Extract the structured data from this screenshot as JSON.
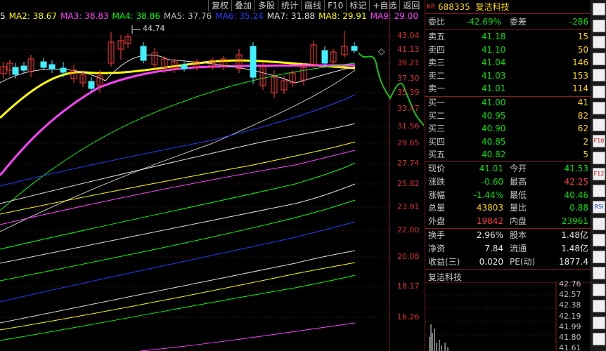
{
  "toolbar": {
    "items": [
      "复权",
      "叠加",
      "多股",
      "统计",
      "画线",
      "F10",
      "标记",
      "+自选",
      "返回"
    ]
  },
  "ma_row": [
    {
      "label": "5",
      "color": "#ffffff"
    },
    {
      "label": "MA2: 38.67",
      "color": "#ffff00"
    },
    {
      "label": "MA3: 38.83",
      "color": "#ff40ff"
    },
    {
      "label": "MA4: 38.86",
      "color": "#00ff00"
    },
    {
      "label": "MA5: 37.76",
      "color": "#c0c0c0"
    },
    {
      "label": "MA6: 35.24",
      "color": "#2040ff"
    },
    {
      "label": "MA7: 31.88",
      "color": "#e0e0e0"
    },
    {
      "label": "MA8: 29.91",
      "color": "#ffff00"
    },
    {
      "label": "MA9: 29.00",
      "color": "#ff40ff"
    }
  ],
  "chart": {
    "high_label": "44.74",
    "price_labels": [
      "43.04",
      "41.13",
      "39.21",
      "37.30",
      "35.39",
      "33.47",
      "31.56",
      "29.65",
      "27.74",
      "25.82",
      "23.91",
      "22.00",
      "20.08",
      "18.17",
      "16.26"
    ],
    "diamond": "◇"
  },
  "quote": {
    "tag": "KR",
    "code": "688335",
    "name": "复洁科技",
    "weibi_label": "委比",
    "weibi_value": "-42.69%",
    "weicha_label": "委差",
    "weicha_value": "-286",
    "asks": [
      {
        "label": "卖五",
        "price": "41.18",
        "vol": "15"
      },
      {
        "label": "卖四",
        "price": "41.10",
        "vol": "50"
      },
      {
        "label": "卖三",
        "price": "41.04",
        "vol": "146"
      },
      {
        "label": "卖二",
        "price": "41.03",
        "vol": "153"
      },
      {
        "label": "卖一",
        "price": "41.01",
        "vol": "114"
      }
    ],
    "bids": [
      {
        "label": "买一",
        "price": "41.00",
        "vol": "41"
      },
      {
        "label": "买二",
        "price": "40.95",
        "vol": "82"
      },
      {
        "label": "买三",
        "price": "40.90",
        "vol": "62"
      },
      {
        "label": "买四",
        "price": "40.85",
        "vol": "2"
      },
      {
        "label": "买五",
        "price": "40.82",
        "vol": "5"
      }
    ],
    "stats": [
      {
        "l1": "现价",
        "v1": "41.01",
        "c1": "green",
        "l2": "今开",
        "v2": "41.53",
        "c2": "green"
      },
      {
        "l1": "涨跌",
        "v1": "-0.60",
        "c1": "green",
        "l2": "最高",
        "v2": "42.25",
        "c2": "red"
      },
      {
        "l1": "涨幅",
        "v1": "-1.44%",
        "c1": "green",
        "l2": "最低",
        "v2": "40.46",
        "c2": "green"
      },
      {
        "l1": "总量",
        "v1": "43803",
        "c1": "yellow",
        "l2": "量比",
        "v2": "0.88",
        "c2": "green"
      },
      {
        "l1": "外盘",
        "v1": "19842",
        "c1": "red",
        "l2": "内盘",
        "v2": "23961",
        "c2": "green"
      }
    ],
    "stats2": [
      {
        "l1": "换手",
        "v1": "2.96%",
        "l2": "股本",
        "v2": "1.48亿"
      },
      {
        "l1": "净资",
        "v1": "7.84",
        "l2": "流通",
        "v2": "1.48亿"
      },
      {
        "l1": "收益(三)",
        "v1": "0.020",
        "l2": "PE(动)",
        "v2": "1877.4"
      }
    ]
  },
  "mini_chart": {
    "title": "复洁科技",
    "price_labels": [
      "42.76",
      "42.57",
      "42.38",
      "42.19",
      "41.99",
      "41.80",
      "41.61"
    ]
  },
  "sidebar": {
    "buttons": [
      "",
      "",
      "",
      "",
      "",
      "",
      "",
      "",
      "F10",
      "",
      "F12",
      "",
      "RSI",
      "",
      "",
      "",
      "",
      "",
      "",
      "",
      ""
    ]
  }
}
